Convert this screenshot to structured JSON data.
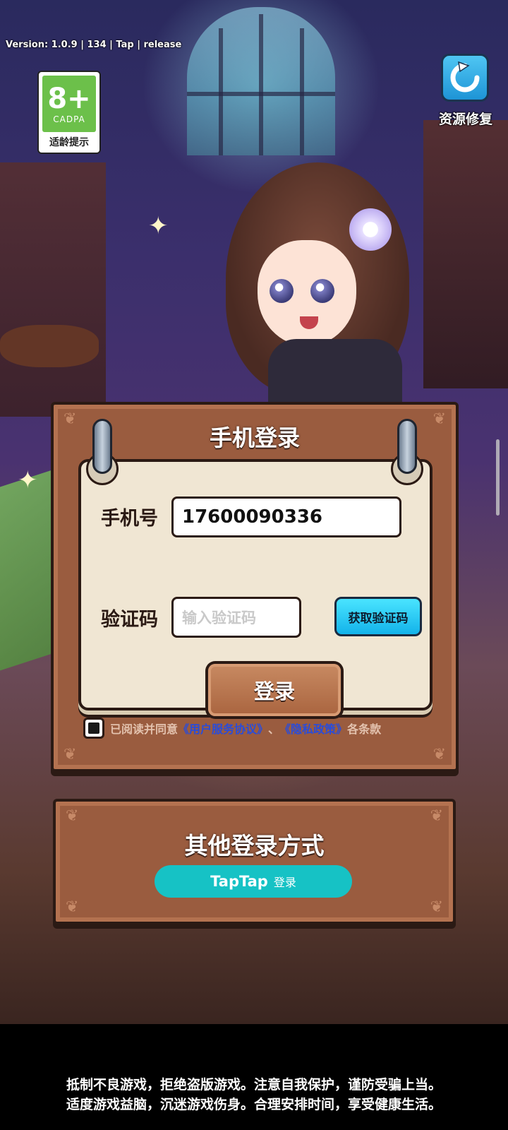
{
  "header": {
    "version": "Version: 1.0.9 | 134 | Tap | release",
    "age_rating": {
      "number": "8+",
      "org": "CADPA",
      "label": "适龄提示",
      "color": "#6cc04a"
    },
    "repair": {
      "icon": "refresh-icon",
      "label": "资源修复",
      "color": "#1e94d6"
    }
  },
  "login_panel": {
    "title": "手机登录",
    "phone_label": "手机号",
    "phone_value": "17600090336",
    "code_label": "验证码",
    "code_placeholder": "输入验证码",
    "get_code_button": "获取验证码",
    "login_button": "登录",
    "agreement": {
      "checked": true,
      "prefix": "已阅读并同意",
      "user_agreement": "《用户服务协议》",
      "separator": "、",
      "privacy_policy": "《隐私政策》",
      "suffix": "各条款"
    }
  },
  "other_login": {
    "title": "其他登录方式",
    "taptap_brand": "TapTap",
    "taptap_label": "登录",
    "taptap_color": "#16c2c5"
  },
  "notice": {
    "line1": "抵制不良游戏，拒绝盗版游戏。注意自我保护，谨防受骗上当。",
    "line2": "适度游戏益脑，沉迷游戏伤身。合理安排时间，享受健康生活。"
  }
}
